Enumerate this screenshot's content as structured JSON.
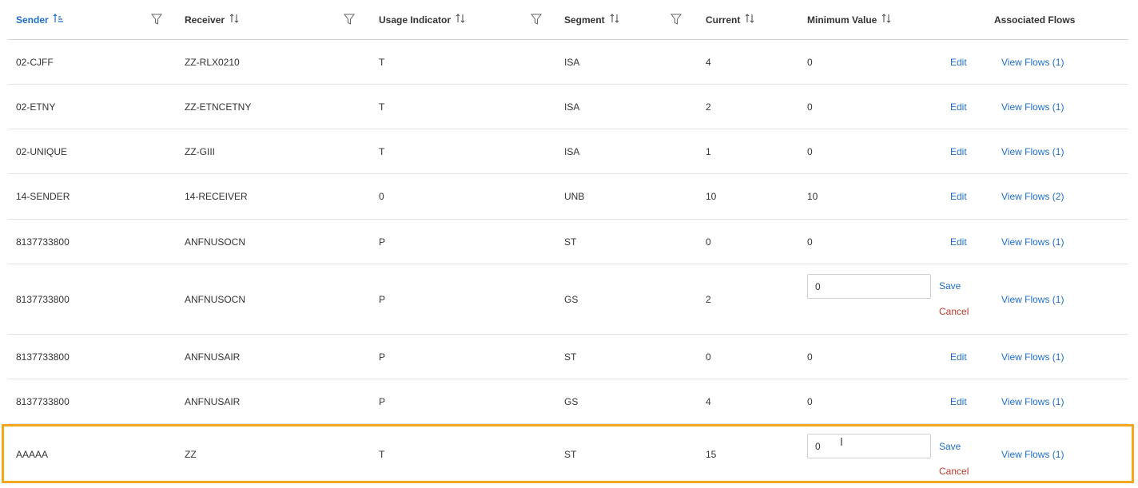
{
  "columns": {
    "sender": "Sender",
    "receiver": "Receiver",
    "usage_indicator": "Usage Indicator",
    "segment": "Segment",
    "current": "Current",
    "minimum_value": "Minimum Value",
    "associated_flows": "Associated Flows"
  },
  "icons": {
    "sort_ascending": "sort-ascending-icon",
    "sort": "sort-icon",
    "filter": "filter-icon"
  },
  "labels": {
    "edit": "Edit",
    "save": "Save",
    "cancel": "Cancel"
  },
  "colors": {
    "link": "#1f6fc4",
    "cancel": "#c0392b",
    "highlight": "#f3a71d"
  },
  "rows": [
    {
      "sender": "02-CJFF",
      "receiver": "ZZ-RLX0210",
      "usage": "T",
      "segment": "ISA",
      "current": "4",
      "min": "0",
      "flows": "View Flows (1)"
    },
    {
      "sender": "02-ETNY",
      "receiver": "ZZ-ETNCETNY",
      "usage": "T",
      "segment": "ISA",
      "current": "2",
      "min": "0",
      "flows": "View Flows (1)"
    },
    {
      "sender": "02-UNIQUE",
      "receiver": "ZZ-GIII",
      "usage": "T",
      "segment": "ISA",
      "current": "1",
      "min": "0",
      "flows": "View Flows (1)"
    },
    {
      "sender": "14-SENDER",
      "receiver": "14-RECEIVER",
      "usage": "0",
      "segment": "UNB",
      "current": "10",
      "min": "10",
      "flows": "View Flows (2)"
    },
    {
      "sender": "8137733800",
      "receiver": "ANFNUSOCN",
      "usage": "P",
      "segment": "ST",
      "current": "0",
      "min": "0",
      "flows": "View Flows (1)"
    },
    {
      "sender": "8137733800",
      "receiver": "ANFNUSOCN",
      "usage": "P",
      "segment": "GS",
      "current": "2",
      "min": "0",
      "flows": "View Flows (1)"
    },
    {
      "sender": "8137733800",
      "receiver": "ANFNUSAIR",
      "usage": "P",
      "segment": "ST",
      "current": "0",
      "min": "0",
      "flows": "View Flows (1)"
    },
    {
      "sender": "8137733800",
      "receiver": "ANFNUSAIR",
      "usage": "P",
      "segment": "GS",
      "current": "4",
      "min": "0",
      "flows": "View Flows (1)"
    },
    {
      "sender": "AAAAA",
      "receiver": "ZZ",
      "usage": "T",
      "segment": "ST",
      "current": "15",
      "min": "0",
      "flows": "View Flows (1)"
    }
  ]
}
